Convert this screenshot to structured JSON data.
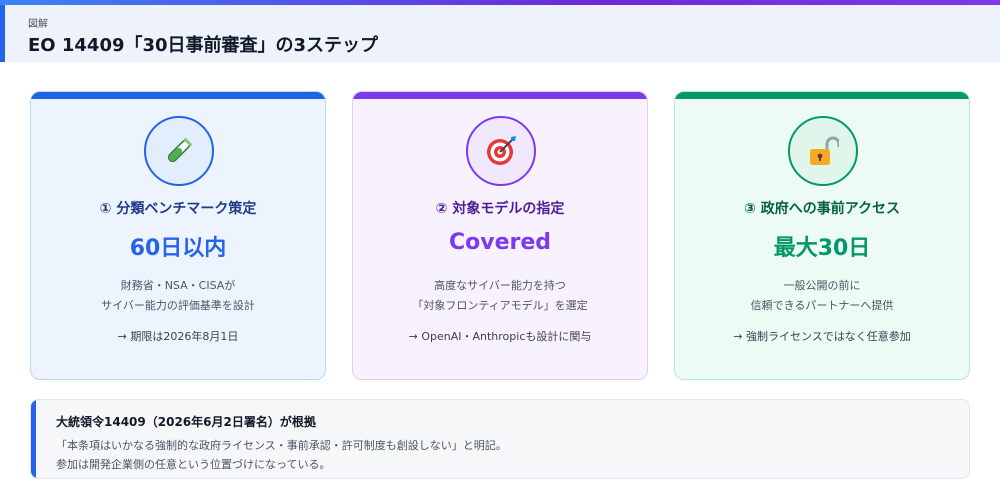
{
  "header": {
    "eyebrow": "図解",
    "title": "EO 14409「30日事前審査」の3ステップ"
  },
  "steps": [
    {
      "icon": "test-tube-icon",
      "title": "① 分類ベンチマーク策定",
      "value": "60日以内",
      "desc_lines": [
        "財務省・NSA・CISAが",
        "サイバー能力の評価基準を設計"
      ],
      "note": "→ 期限は2026年8月1日",
      "accent_color": "#2563eb"
    },
    {
      "icon": "target-dart-icon",
      "title": "② 対象モデルの指定",
      "value": "Covered",
      "desc_lines": [
        "高度なサイバー能力を持つ",
        "「対象フロンティアモデル」を選定"
      ],
      "note": "→ OpenAI・Anthropicも設計に関与",
      "accent_color": "#7c3aed"
    },
    {
      "icon": "unlocked-padlock-icon",
      "title": "③ 政府への事前アクセス",
      "value": "最大30日",
      "desc_lines": [
        "一般公開の前に",
        "信頼できるパートナーへ提供"
      ],
      "note": "→ 強制ライセンスではなく任意参加",
      "accent_color": "#059669"
    }
  ],
  "footer": {
    "title": "大統領令14409（2026年6月2日署名）が根拠",
    "lines": [
      "「本条項はいかなる強制的な政府ライセンス・事前承認・許可制度も創設しない」と明記。",
      "参加は開発企業側の任意という位置づけになっている。"
    ]
  }
}
